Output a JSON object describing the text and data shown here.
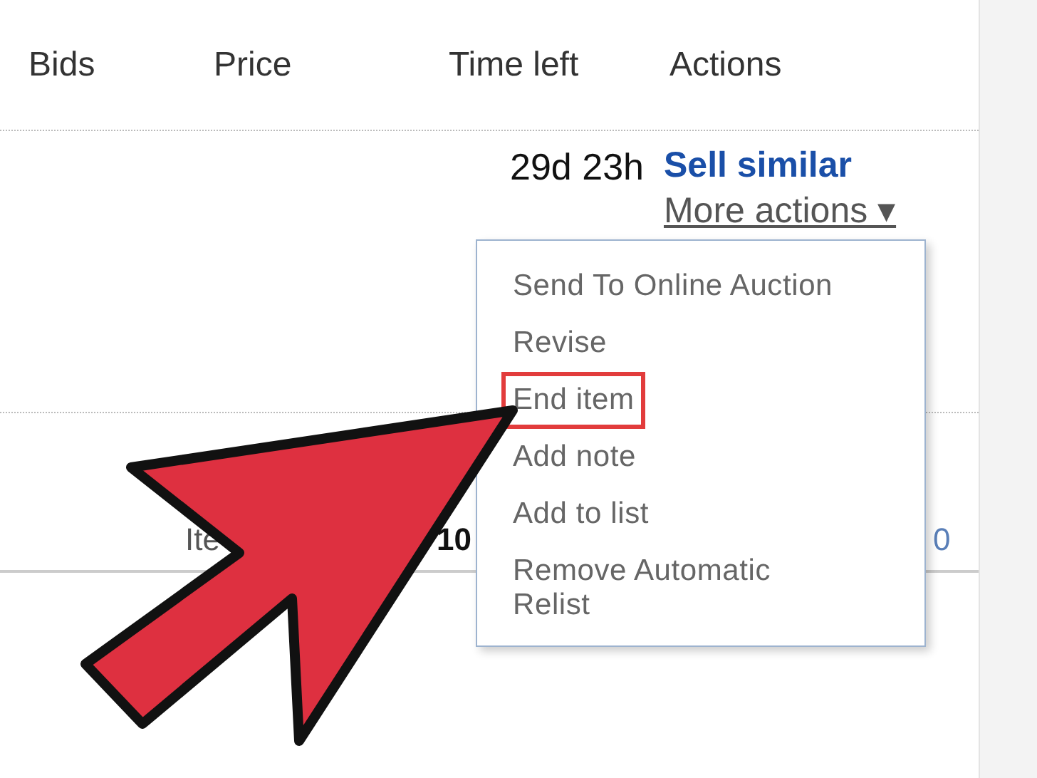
{
  "table": {
    "columns": [
      "Bids",
      "Price",
      "Time left",
      "Actions"
    ],
    "rows": [
      {
        "time_left": "29d 23h",
        "primary_action": "Sell similar",
        "more_actions": "More actions ▾"
      },
      {
        "column_1": "Ite",
        "column_2": "10",
        "column_4": "0"
      }
    ]
  },
  "menu": {
    "items": [
      {
        "label": "Send To Online Auction",
        "highlighted": false
      },
      {
        "label": "Revise",
        "highlighted": false
      },
      {
        "label": "End item",
        "highlighted": true
      },
      {
        "label": "Add note",
        "highlighted": false
      },
      {
        "label": "Add to list",
        "highlighted": false
      },
      {
        "label": "Remove Automatic Relist",
        "highlighted": false
      }
    ]
  }
}
